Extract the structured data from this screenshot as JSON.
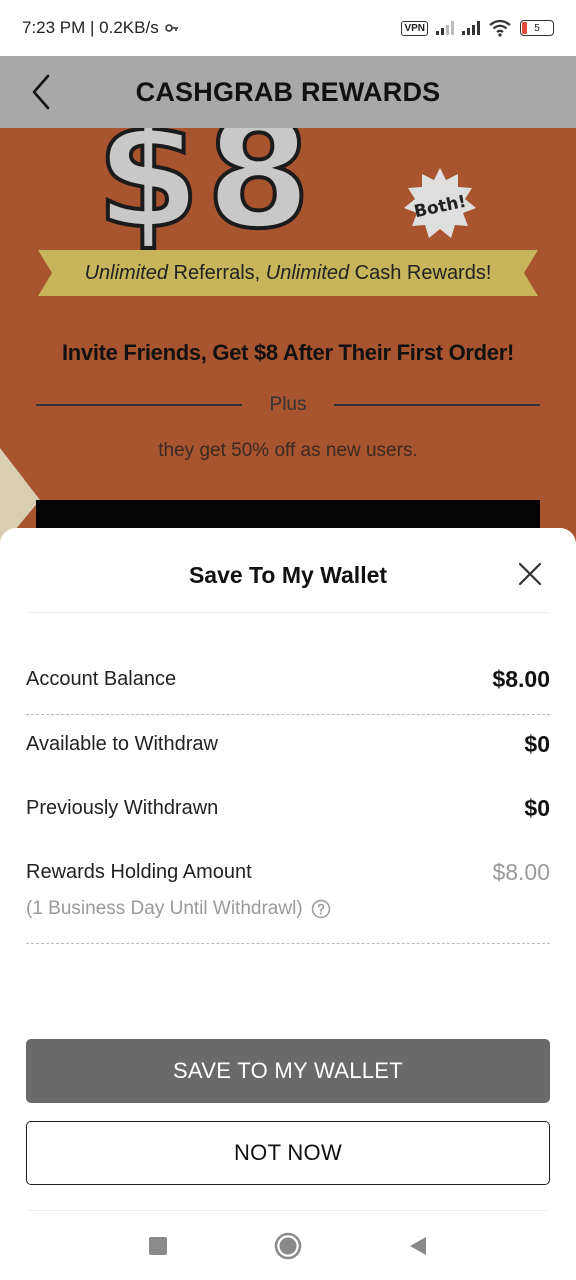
{
  "status_bar": {
    "time_speed": "7:23 PM | 0.2KB/s",
    "vpn": "VPN",
    "battery": "5"
  },
  "header": {
    "title": "CASHGRAB REWARDS"
  },
  "promo": {
    "big_text": "$8",
    "badge": "Both!",
    "banner_italic_1": "Unlimited",
    "banner_text_1": " Referrals, ",
    "banner_italic_2": "Unlimited",
    "banner_text_2": " Cash Rewards!",
    "invite_headline": "Invite Friends, Get $8 After Their First Order!",
    "plus": "Plus",
    "subtext": "they get 50% off as new users."
  },
  "sheet": {
    "title": "Save To My Wallet",
    "rows": [
      {
        "label": "Account Balance",
        "value": "$8.00"
      },
      {
        "label": "Available to Withdraw",
        "value": "$0"
      },
      {
        "label": "Previously Withdrawn",
        "value": "$0"
      },
      {
        "label": "Rewards Holding Amount",
        "value": "$8.00"
      }
    ],
    "holding_note": "(1 Business Day Until Withdrawl)",
    "save_button": "SAVE TO MY WALLET",
    "not_now_button": "NOT NOW"
  },
  "colors": {
    "header_bg": "#a8a8a8",
    "promo_bg": "#a8542f",
    "banner": "#c8b45a",
    "primary_button": "#6a6a6a"
  }
}
